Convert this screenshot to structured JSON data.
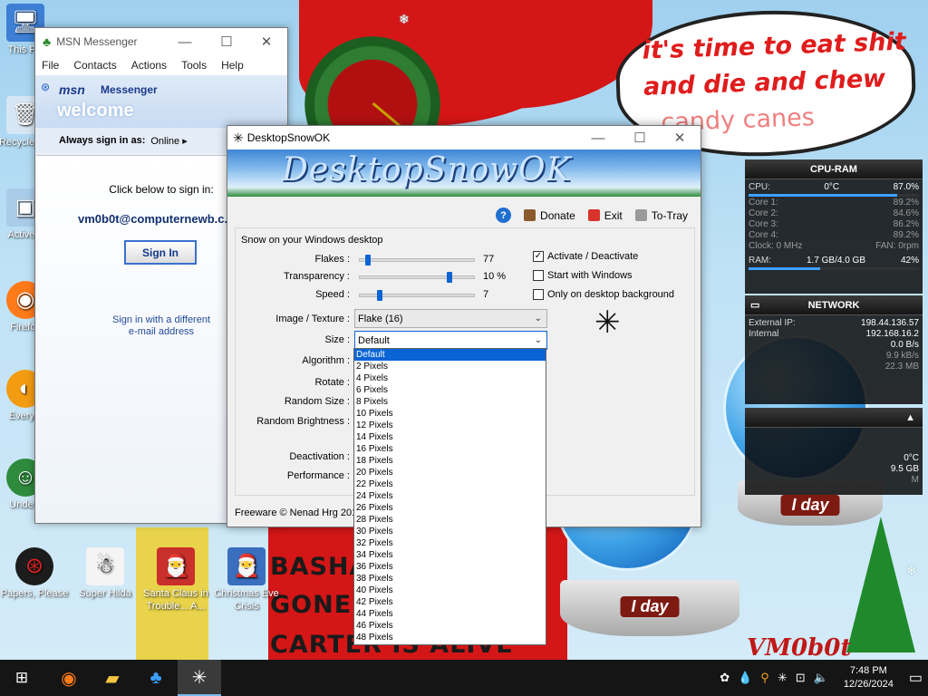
{
  "wallpaper": {
    "speech": [
      "it's time to eat shit",
      "and die and chew",
      "candy canes"
    ],
    "banner": [
      "BASHA",
      "GONE",
      "CARTER IS ALIVE"
    ],
    "globes": [
      "I day",
      "I day"
    ],
    "signature": "VM0b0t"
  },
  "desktop_icons": [
    {
      "label": "This PC",
      "icon": "computer-icon"
    },
    {
      "label": "Recycle Bin",
      "icon": "recycle-bin-icon"
    },
    {
      "label": "Active...",
      "icon": "app-icon"
    },
    {
      "label": "Firefox",
      "icon": "firefox-icon"
    },
    {
      "label": "Every...",
      "icon": "app-icon"
    },
    {
      "label": "Unde...",
      "icon": "app-icon"
    },
    {
      "label": "Papers, Please",
      "icon": "game-icon"
    },
    {
      "label": "Super Hilda",
      "icon": "game-icon"
    },
    {
      "label": "Santa Claus in Trouble... A...",
      "icon": "game-icon"
    },
    {
      "label": "Christmas Eve Crisis",
      "icon": "game-icon"
    }
  ],
  "msn": {
    "title": "MSN Messenger",
    "menu": [
      "File",
      "Contacts",
      "Actions",
      "Tools",
      "Help"
    ],
    "brand": "msn",
    "brand2": "Messenger",
    "welcome": "welcome",
    "always_sign_in_as": "Always sign in as:",
    "status": "Online",
    "click_below": "Click below to sign in:",
    "email": "vm0b0t@computernewb.c...",
    "sign_in": "Sign In",
    "different_line1": "Sign in with a different",
    "different_line2": "e-mail address"
  },
  "snow": {
    "title": "DesktopSnowOK",
    "banner": "DesktopSnowOK",
    "toolbar": {
      "help": "?",
      "donate": "Donate",
      "exit": "Exit",
      "totray": "To-Tray"
    },
    "group_title": "Snow on your Windows desktop",
    "flakes_label": "Flakes :",
    "flakes_value": "77",
    "flakes_level": 0.05,
    "transparency_label": "Transparency :",
    "transparency_value": "10 %",
    "transparency_level": 0.76,
    "speed_label": "Speed :",
    "speed_value": "7",
    "speed_level": 0.15,
    "activate": "Activate / Deactivate",
    "start_windows": "Start with Windows",
    "only_desktop": "Only on desktop background",
    "image_label": "Image / Texture :",
    "image_value": "Flake (16)",
    "size_label": "Size :",
    "size_value": "Default",
    "algorithm_label": "Algorithm :",
    "rotate_label": "Rotate :",
    "random_size_label": "Random Size :",
    "random_brightness_label": "Random Brightness :",
    "deactivation_label": "Deactivation :",
    "performance_label": "Performance :",
    "footer": "Freeware © Nenad Hrg 201",
    "size_options": [
      "Default",
      "2 Pixels",
      "4 Pixels",
      "6 Pixels",
      "8 Pixels",
      "10 Pixels",
      "12 Pixels",
      "14 Pixels",
      "16 Pixels",
      "18 Pixels",
      "20 Pixels",
      "22 Pixels",
      "24 Pixels",
      "26 Pixels",
      "28 Pixels",
      "30 Pixels",
      "32 Pixels",
      "34 Pixels",
      "36 Pixels",
      "38 Pixels",
      "40 Pixels",
      "42 Pixels",
      "44 Pixels",
      "46 Pixels",
      "48 Pixels"
    ]
  },
  "gadget_cpu": {
    "title": "CPU-RAM",
    "cpu_label": "CPU:",
    "cpu_temp": "0°C",
    "cpu_pct": "87.0%",
    "cpu_level": 0.87,
    "cores": [
      {
        "k": "Core 1:",
        "v": "89.2%"
      },
      {
        "k": "Core 2:",
        "v": "84.6%"
      },
      {
        "k": "Core 3:",
        "v": "86.2%"
      },
      {
        "k": "Core 4:",
        "v": "89.2%"
      }
    ],
    "clock": "Clock: 0 MHz",
    "fan": "FAN: 0rpm",
    "ram_label": "RAM:",
    "ram_value": "1.7 GB/4.0 GB",
    "ram_pct": "42%",
    "ram_level": 0.42
  },
  "gadget_net": {
    "title": "NETWORK",
    "external_label": "External IP:",
    "external_ip": "198.44.136.57",
    "internal_label": "Internal",
    "internal_ip": "192.168.16.2",
    "up": "0.0 B/s",
    "down": "9.9 kB/s",
    "total": "22.3 MB"
  },
  "gadget_disk": {
    "temp": "0°C",
    "free": "9.5 GB",
    "m": "M"
  },
  "taskbar": {
    "buttons": [
      "windows-start-icon",
      "firefox-icon",
      "file-explorer-icon",
      "msn-messenger-icon",
      "snow-app-icon"
    ],
    "time": "7:48 PM",
    "date": "12/26/2024"
  },
  "colors": {
    "accent": "#0a64d4",
    "wall_red": "#d41616"
  }
}
